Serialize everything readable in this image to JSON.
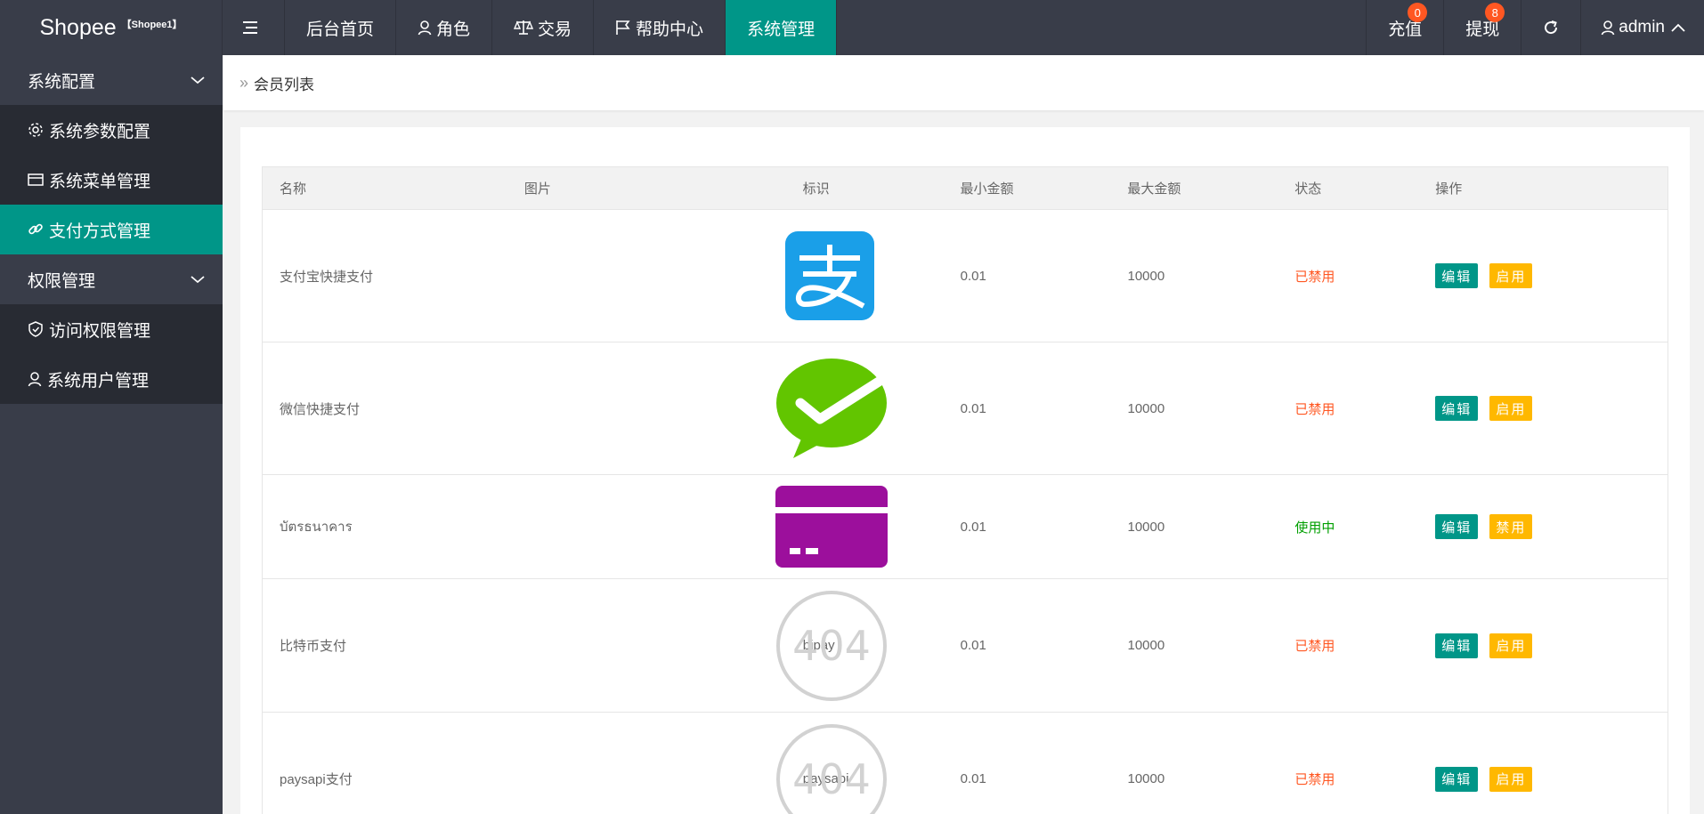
{
  "header": {
    "brand": "Shopee",
    "brand_tag": "【Shopee1】",
    "nav": [
      {
        "label": "后台首页"
      },
      {
        "label": "角色"
      },
      {
        "label": "交易"
      },
      {
        "label": "帮助中心"
      },
      {
        "label": "系统管理"
      }
    ],
    "right": {
      "recharge_label": "充值",
      "recharge_count": "0",
      "withdraw_label": "提现",
      "withdraw_count": "8",
      "user": "admin"
    }
  },
  "sidebar": {
    "group1": "系统配置",
    "items1": [
      "系统参数配置",
      "系统菜单管理",
      "支付方式管理"
    ],
    "group2": "权限管理",
    "items2": [
      "访问权限管理",
      "系统用户管理"
    ]
  },
  "breadcrumb": "会员列表",
  "table": {
    "headers": [
      "名称",
      "图片",
      "标识",
      "最小金额",
      "最大金额",
      "状态",
      "操作"
    ],
    "rows": [
      {
        "name": "支付宝快捷支付",
        "icon": "alipay-icon",
        "code": "zfb",
        "min": "0.01",
        "max": "10000",
        "status": "已禁用",
        "edit": "编辑",
        "toggle": "启用"
      },
      {
        "name": "微信快捷支付",
        "icon": "wechat-icon",
        "code": "wx",
        "min": "0.01",
        "max": "10000",
        "status": "已禁用",
        "edit": "编辑",
        "toggle": "启用"
      },
      {
        "name": "บัตรธนาคาร",
        "icon": "card-icon",
        "code": "card",
        "min": "0.01",
        "max": "10000",
        "status": "使用中",
        "edit": "编辑",
        "toggle": "禁用"
      },
      {
        "name": "比特币支付",
        "icon": "404-placeholder-icon",
        "code": "bipay",
        "min": "0.01",
        "max": "10000",
        "status": "已禁用",
        "edit": "编辑",
        "toggle": "启用"
      },
      {
        "name": "paysapi支付",
        "icon": "404-placeholder-icon",
        "code": "paysapi",
        "min": "0.01",
        "max": "10000",
        "status": "已禁用",
        "edit": "编辑",
        "toggle": "启用"
      }
    ],
    "placeholder_text": "404"
  },
  "colors": {
    "header_bg": "#393d49",
    "accent": "#009688",
    "warning": "#ffb800",
    "danger": "#ff5722",
    "success": "#009f00"
  }
}
